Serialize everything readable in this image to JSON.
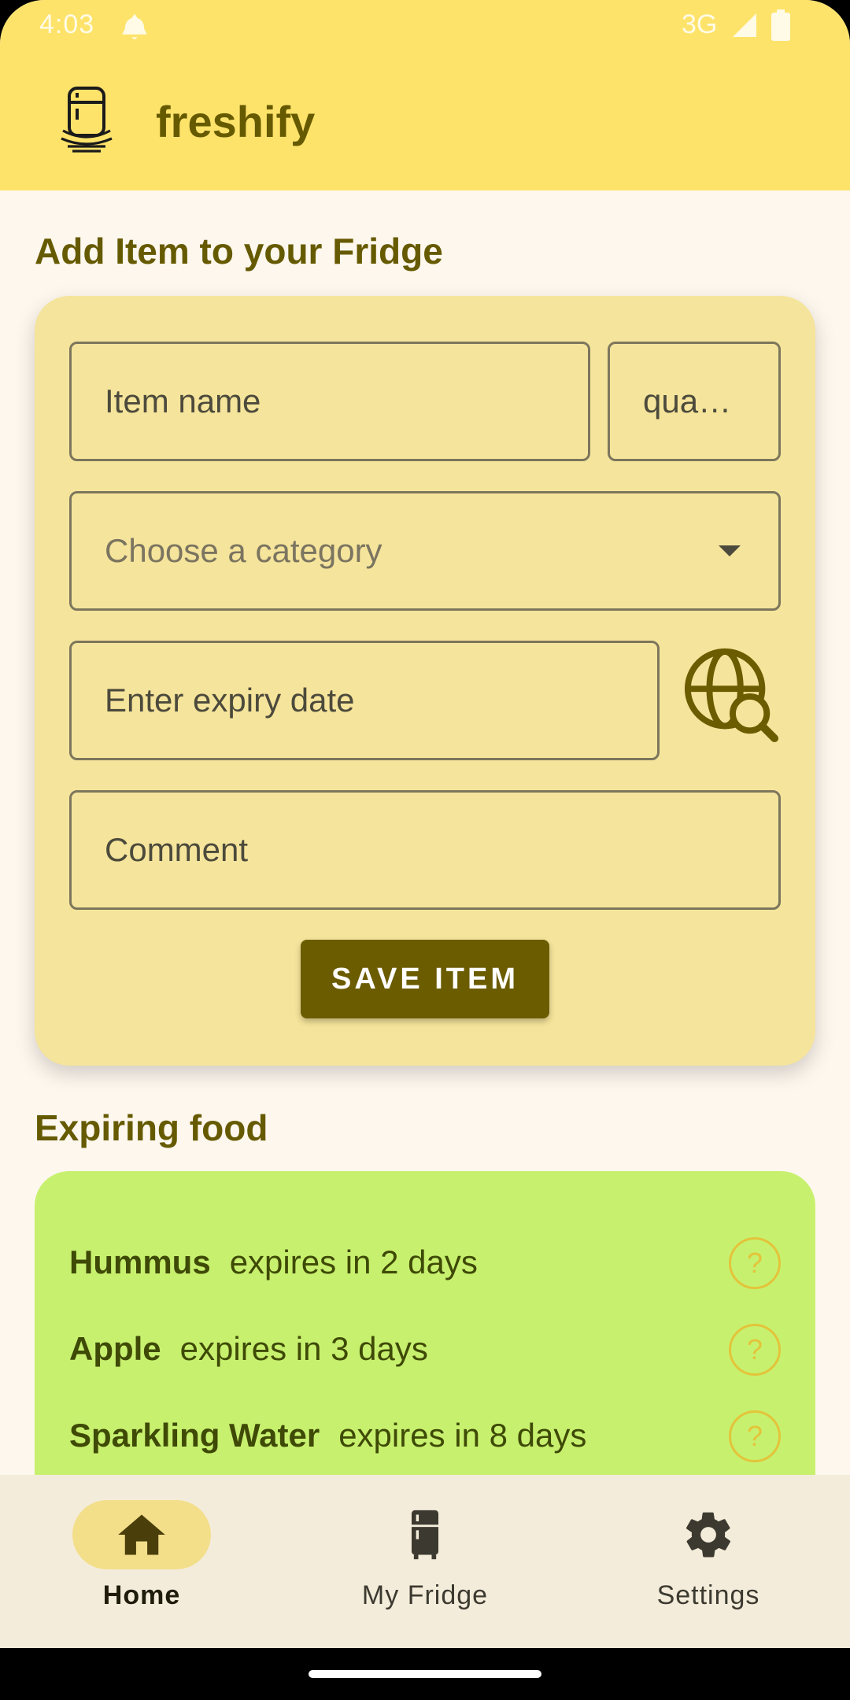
{
  "status_bar": {
    "time": "4:03",
    "network": "3G"
  },
  "app": {
    "title": "freshify",
    "logo_icon": "fridge-logo-icon"
  },
  "form": {
    "title": "Add Item to your Fridge",
    "item_name_placeholder": "Item name",
    "quantity_placeholder": "qua…",
    "category_placeholder": "Choose a category",
    "expiry_placeholder": "Enter expiry date",
    "comment_placeholder": "Comment",
    "save_label": "SAVE ITEM",
    "search_icon": "globe-search-icon"
  },
  "expiring": {
    "title": "Expiring food",
    "items": [
      {
        "name": "Hummus",
        "text": "expires in 2 days",
        "icon": "?"
      },
      {
        "name": "Apple",
        "text": "expires in 3 days",
        "icon": "?"
      },
      {
        "name": "Sparkling Water",
        "text": "expires in 8 days",
        "icon": "?"
      }
    ]
  },
  "nav": {
    "items": [
      {
        "label": "Home",
        "icon": "home-icon",
        "active": true
      },
      {
        "label": "My Fridge",
        "icon": "fridge-icon",
        "active": false
      },
      {
        "label": "Settings",
        "icon": "gear-icon",
        "active": false
      }
    ]
  },
  "colors": {
    "app_bar": "#fee36b",
    "card": "#f5e49b",
    "primary": "#6b5c00",
    "expiring_card": "#c8f06f",
    "nav_bar": "#f4ecda"
  }
}
